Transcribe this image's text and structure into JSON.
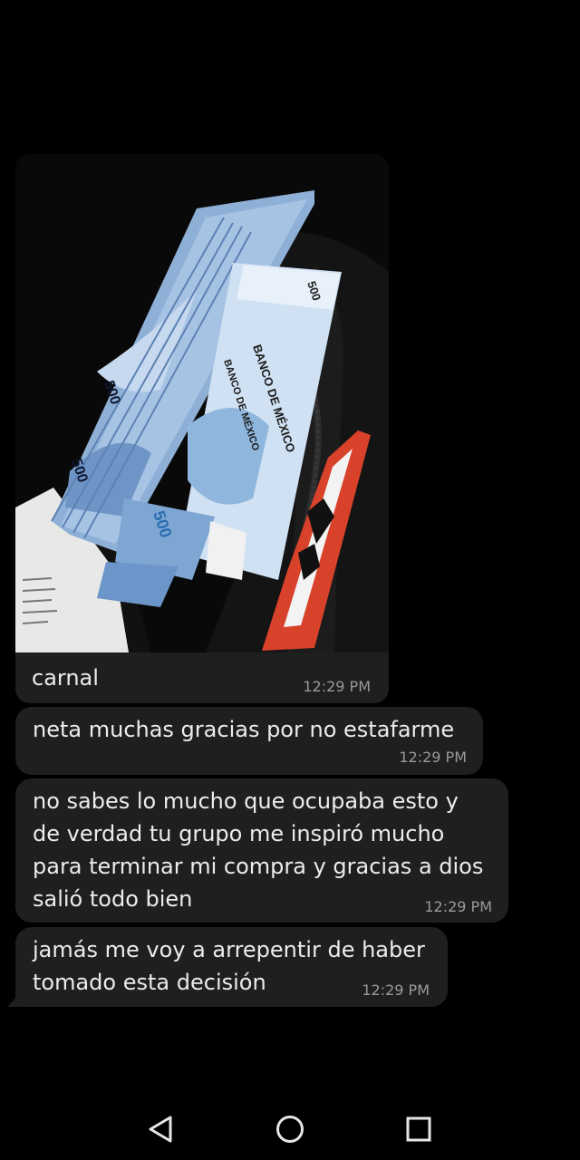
{
  "conversation": {
    "image_message": {
      "photo_alt": "Photo of banknotes in a bag",
      "banknote_text": [
        "BANCO DE MÉXICO",
        "BANCO DE MÉXICO",
        "500",
        "500",
        "500",
        "500"
      ],
      "caption": "carnal",
      "time": "12:29 PM"
    },
    "messages": [
      {
        "text": "neta muchas gracias por no estafarme",
        "time": "12:29 PM"
      },
      {
        "lines": [
          "no sabes lo mucho que ocupaba esto y",
          "de verdad tu grupo me inspiró mucho",
          "para terminar mi compra y gracias a dios",
          "salió todo bien"
        ],
        "time": "12:29 PM"
      },
      {
        "lines": [
          "jamás me voy a arrepentir de haber",
          "tomado esta decisión"
        ],
        "time": "12:29 PM"
      }
    ]
  },
  "colors": {
    "background": "#000000",
    "bubble": "#1f1f1f",
    "text": "#ececec",
    "timestamp": "#9a9a9a"
  },
  "navbar": {
    "back_icon": "triangle-back-icon",
    "home_icon": "circle-home-icon",
    "recents_icon": "square-recents-icon"
  }
}
